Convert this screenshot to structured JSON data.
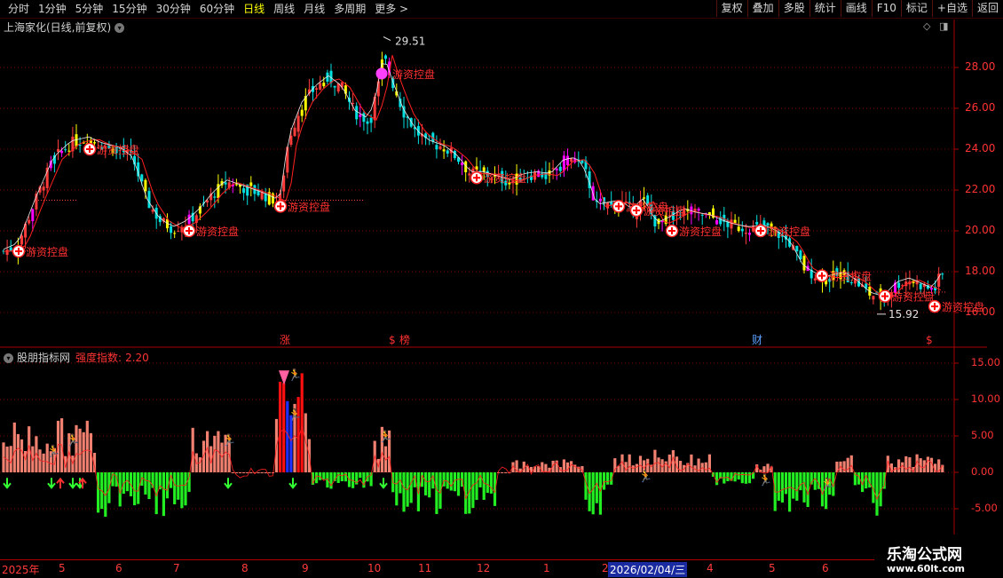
{
  "toolbar": {
    "periods": [
      "分时",
      "1分钟",
      "5分钟",
      "15分钟",
      "30分钟",
      "60分钟",
      "日线",
      "周线",
      "月线",
      "多周期",
      "更多 >"
    ],
    "active_period": "日线",
    "buttons": [
      "复权",
      "叠加",
      "多股",
      "统计",
      "画线",
      "F10",
      "标记",
      "+自选",
      "返回"
    ]
  },
  "main_header": {
    "title": "上海家化(日线,前复权)"
  },
  "indicator_header": {
    "name": "股朋指标网",
    "label": "强度指数:",
    "value": "2.20"
  },
  "main_axis": {
    "ticks": [
      "28.00",
      "26.00",
      "24.00",
      "22.00",
      "20.00",
      "18.00",
      "16.00"
    ]
  },
  "ind_axis": {
    "ticks": [
      "15.00",
      "10.00",
      "5.00",
      "0.00",
      "-5.00"
    ]
  },
  "annotations": {
    "high_price": "29.51",
    "low_price": "15.92",
    "signal_text": "游资控盘",
    "event_marks": [
      "涨",
      "$",
      "榜",
      "财",
      "$"
    ]
  },
  "x_axis": {
    "labels": [
      "2025年",
      "5",
      "6",
      "7",
      "8",
      "9",
      "10",
      "11",
      "12",
      "1",
      "2",
      "3",
      "4",
      "5",
      "6"
    ],
    "highlight": "2026/02/04/三"
  },
  "watermark": {
    "line1": "乐淘公式网",
    "line2": "www.60lt.com"
  },
  "colors": {
    "up": "#ff3c3c",
    "down": "#00e0e0",
    "yellow": "#ffff00",
    "ma": "#ff2020",
    "pos_bar": "#f08070",
    "neg_bar": "#22ee22"
  }
}
